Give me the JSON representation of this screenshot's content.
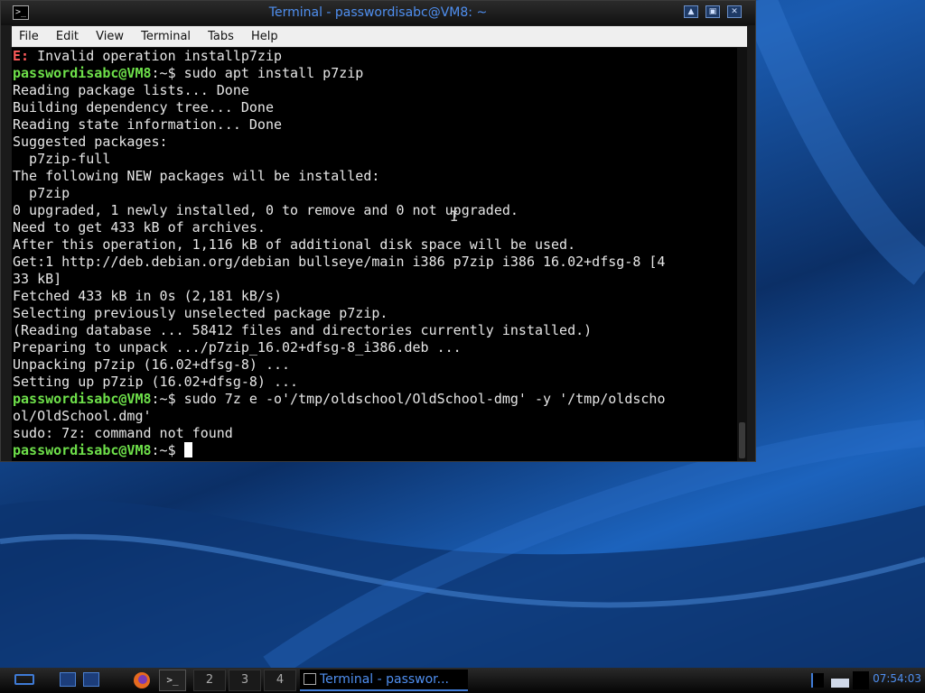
{
  "window": {
    "title": "Terminal - passwordisabc@VM8: ~",
    "icon": "terminal-icon",
    "controls": [
      "pin-icon",
      "maximize-icon",
      "close-icon"
    ]
  },
  "menu": [
    "File",
    "Edit",
    "View",
    "Terminal",
    "Tabs",
    "Help"
  ],
  "terminal": {
    "prompt_user": "passwordisabc@VM8",
    "lines": [
      {
        "type": "error",
        "prefix": "E:",
        "text": " Invalid operation installp7zip"
      },
      {
        "type": "prompt",
        "path": ":~$",
        "text": " sudo apt install p7zip"
      },
      {
        "type": "out",
        "text": "Reading package lists... Done"
      },
      {
        "type": "out",
        "text": "Building dependency tree... Done"
      },
      {
        "type": "out",
        "text": "Reading state information... Done"
      },
      {
        "type": "out",
        "text": "Suggested packages:"
      },
      {
        "type": "out",
        "text": "  p7zip-full"
      },
      {
        "type": "out",
        "text": "The following NEW packages will be installed:"
      },
      {
        "type": "out",
        "text": "  p7zip"
      },
      {
        "type": "out",
        "text": "0 upgraded, 1 newly installed, 0 to remove and 0 not upgraded."
      },
      {
        "type": "out",
        "text": "Need to get 433 kB of archives."
      },
      {
        "type": "out",
        "text": "After this operation, 1,116 kB of additional disk space will be used."
      },
      {
        "type": "out",
        "text": "Get:1 http://deb.debian.org/debian bullseye/main i386 p7zip i386 16.02+dfsg-8 [4"
      },
      {
        "type": "out",
        "text": "33 kB]"
      },
      {
        "type": "out",
        "text": "Fetched 433 kB in 0s (2,181 kB/s)"
      },
      {
        "type": "out",
        "text": "Selecting previously unselected package p7zip."
      },
      {
        "type": "out",
        "text": "(Reading database ... 58412 files and directories currently installed.)"
      },
      {
        "type": "out",
        "text": "Preparing to unpack .../p7zip_16.02+dfsg-8_i386.deb ..."
      },
      {
        "type": "out",
        "text": "Unpacking p7zip (16.02+dfsg-8) ..."
      },
      {
        "type": "out",
        "text": "Setting up p7zip (16.02+dfsg-8) ..."
      },
      {
        "type": "prompt",
        "path": ":~$",
        "text": " sudo 7z e -o'/tmp/oldschool/OldSchool-dmg' -y '/tmp/oldscho"
      },
      {
        "type": "out",
        "text": "ol/OldSchool.dmg'"
      },
      {
        "type": "out",
        "text": "sudo: 7z: command not found"
      },
      {
        "type": "prompt",
        "path": ":~$",
        "text": " ",
        "cursor": true
      }
    ]
  },
  "taskbar": {
    "desktops": [
      "2",
      "3",
      "4"
    ],
    "task_label": "Terminal - passwor...",
    "clock": "07:54:03",
    "colors": {
      "accent": "#4f8ff0",
      "prompt": "#6ee04a",
      "error": "#ff5b5b"
    }
  }
}
